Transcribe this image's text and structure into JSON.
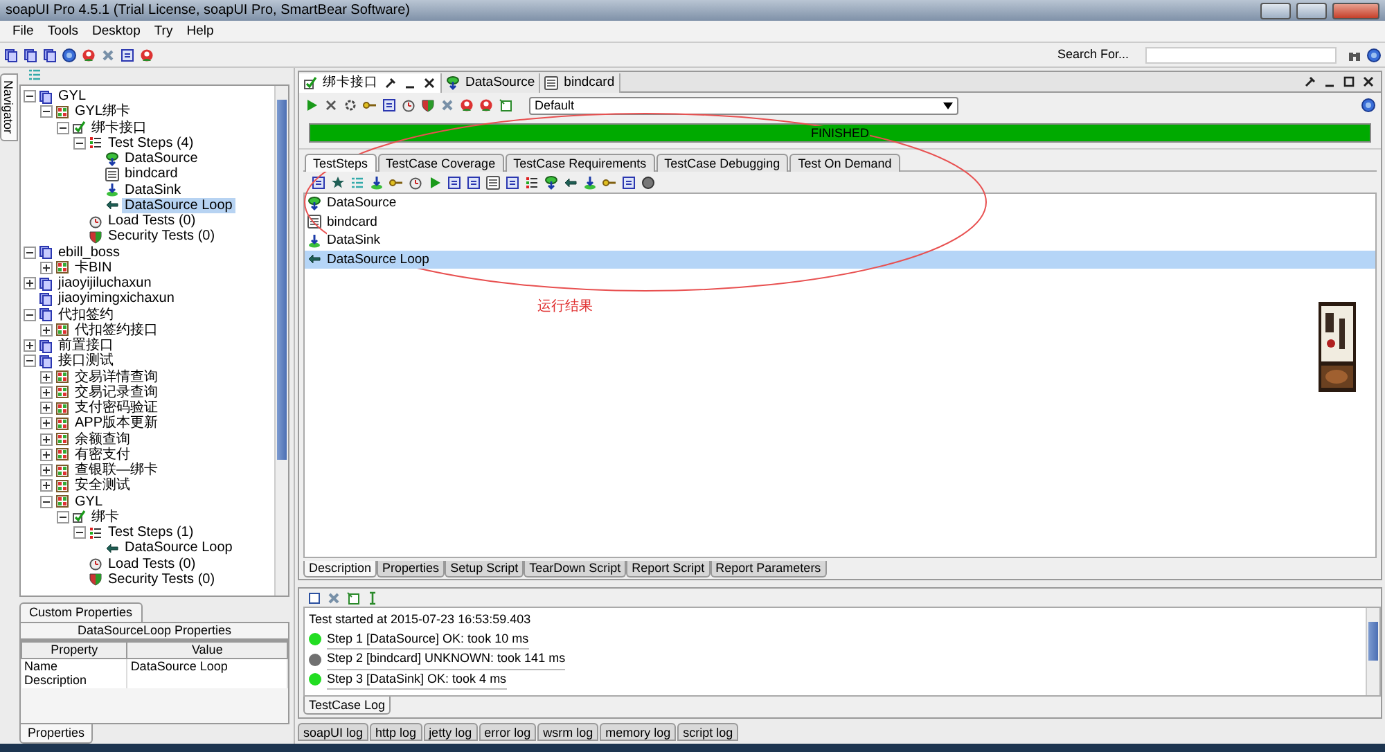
{
  "window": {
    "title": "soapUI Pro 4.5.1 (Trial License, soapUI Pro, SmartBear Software)"
  },
  "menu": [
    "File",
    "Tools",
    "Desktop",
    "Try",
    "Help"
  ],
  "search": {
    "label": "Search For..."
  },
  "navigator": {
    "tab": "Navigator",
    "tree": [
      {
        "label": "GYL",
        "kind": "project",
        "expanded": true,
        "selected": false,
        "children": [
          {
            "label": "GYL绑卡",
            "kind": "suite",
            "expanded": true,
            "selected": false,
            "children": [
              {
                "label": "绑卡接口",
                "kind": "case",
                "expanded": true,
                "selected": false,
                "children": [
                  {
                    "label": "Test Steps (4)",
                    "kind": "steps",
                    "expanded": true,
                    "selected": false,
                    "children": [
                      {
                        "label": "DataSource",
                        "kind": "datasource",
                        "selected": false
                      },
                      {
                        "label": "bindcard",
                        "kind": "request",
                        "selected": false
                      },
                      {
                        "label": "DataSink",
                        "kind": "datasink",
                        "selected": false
                      },
                      {
                        "label": "DataSource Loop",
                        "kind": "loop",
                        "selected": true
                      }
                    ]
                  },
                  {
                    "label": "Load Tests (0)",
                    "kind": "load",
                    "selected": false
                  },
                  {
                    "label": "Security Tests (0)",
                    "kind": "security",
                    "selected": false
                  }
                ]
              }
            ]
          }
        ]
      },
      {
        "label": "ebill_boss",
        "kind": "project",
        "expanded": true,
        "selected": false,
        "children": [
          {
            "label": "卡BIN",
            "kind": "suite",
            "expanded": false,
            "selected": false
          }
        ]
      },
      {
        "label": "jiaoyijiluchaxun",
        "kind": "project",
        "expanded": false,
        "selected": false
      },
      {
        "label": "jiaoyimingxichaxun",
        "kind": "project",
        "selected": false
      },
      {
        "label": "代扣签约",
        "kind": "project",
        "expanded": true,
        "selected": false,
        "children": [
          {
            "label": "代扣签约接口",
            "kind": "suite",
            "expanded": false,
            "selected": false
          }
        ]
      },
      {
        "label": "前置接口",
        "kind": "project",
        "expanded": false,
        "selected": false
      },
      {
        "label": "接口测试",
        "kind": "project",
        "expanded": true,
        "selected": false,
        "children": [
          {
            "label": "交易详情查询",
            "kind": "suite",
            "expanded": false,
            "selected": false
          },
          {
            "label": "交易记录查询",
            "kind": "suite",
            "expanded": false,
            "selected": false
          },
          {
            "label": "支付密码验证",
            "kind": "suite",
            "expanded": false,
            "selected": false
          },
          {
            "label": "APP版本更新",
            "kind": "suite",
            "expanded": false,
            "selected": false
          },
          {
            "label": "余额查询",
            "kind": "suite",
            "expanded": false,
            "selected": false
          },
          {
            "label": "有密支付",
            "kind": "suite",
            "expanded": false,
            "selected": false
          },
          {
            "label": "查银联—绑卡",
            "kind": "suite",
            "expanded": false,
            "selected": false
          },
          {
            "label": "安全测试",
            "kind": "suite",
            "expanded": false,
            "selected": false
          },
          {
            "label": "GYL",
            "kind": "suite",
            "expanded": true,
            "selected": false,
            "children": [
              {
                "label": "绑卡",
                "kind": "case",
                "expanded": true,
                "selected": false,
                "children": [
                  {
                    "label": "Test Steps (1)",
                    "kind": "steps",
                    "expanded": true,
                    "selected": false,
                    "children": [
                      {
                        "label": "DataSource Loop",
                        "kind": "loop",
                        "selected": false
                      }
                    ]
                  },
                  {
                    "label": "Load Tests (0)",
                    "kind": "load",
                    "selected": false
                  },
                  {
                    "label": "Security Tests (0)",
                    "kind": "security",
                    "selected": false
                  }
                ]
              }
            ]
          }
        ]
      }
    ]
  },
  "properties_panel": {
    "tab": "Custom Properties",
    "title": "DataSourceLoop Properties",
    "columns": [
      "Property",
      "Value"
    ],
    "rows": [
      {
        "property": "Name",
        "value": "DataSource Loop"
      },
      {
        "property": "Description"
      }
    ],
    "bottom_tab": "Properties"
  },
  "editor": {
    "tabs": [
      {
        "label": "绑卡接口",
        "kind": "case",
        "selected": true
      },
      {
        "label": "DataSource",
        "kind": "datasource",
        "selected": false
      },
      {
        "label": "bindcard",
        "kind": "request",
        "selected": false
      }
    ],
    "environment": "Default",
    "progress": {
      "label": "FINISHED",
      "level": 1
    },
    "subtabs": [
      {
        "label": "TestSteps",
        "selected": true
      },
      {
        "label": "TestCase Coverage",
        "selected": false
      },
      {
        "label": "TestCase Requirements",
        "selected": false
      },
      {
        "label": "TestCase Debugging",
        "selected": false
      },
      {
        "label": "Test On Demand",
        "selected": false
      }
    ],
    "steps": [
      {
        "label": "DataSource",
        "kind": "datasource",
        "selected": false
      },
      {
        "label": "bindcard",
        "kind": "request",
        "selected": false
      },
      {
        "label": "DataSink",
        "kind": "datasink",
        "selected": false
      },
      {
        "label": "DataSource Loop",
        "kind": "loop",
        "selected": true
      }
    ],
    "annotation": "运行结果",
    "bottom_tabs": [
      {
        "label": "Description",
        "selected": true
      },
      {
        "label": "Properties",
        "selected": false
      },
      {
        "label": "Setup Script",
        "selected": false
      },
      {
        "label": "TearDown Script",
        "selected": false
      },
      {
        "label": "Report Script",
        "selected": false
      },
      {
        "label": "Report Parameters",
        "selected": false
      }
    ]
  },
  "log": {
    "started": "Test started at 2015-07-23 16:53:59.403",
    "entries": [
      {
        "text": "Step 1 [DataSource] OK: took 10 ms",
        "color": "#22dd22"
      },
      {
        "text": "Step 2 [bindcard] UNKNOWN: took 141 ms",
        "color": "#707070"
      },
      {
        "text": "Step 3 [DataSink] OK: took 4 ms",
        "color": "#22dd22"
      }
    ],
    "tab": "TestCase Log"
  },
  "log_tabs": [
    "soapUI log",
    "http log",
    "jetty log",
    "error log",
    "wsrm log",
    "memory log",
    "script log"
  ]
}
